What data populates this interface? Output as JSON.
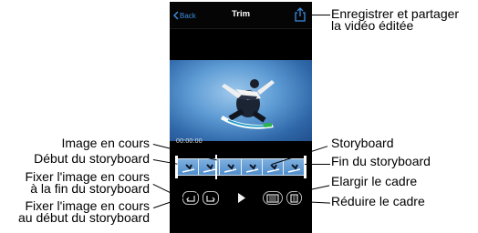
{
  "navbar": {
    "back_label": "Back",
    "title": "Trim"
  },
  "timecode": "00:00:00",
  "storyboard": {
    "frame_count": 6
  },
  "callouts": {
    "share": [
      "Enregistrer et partager",
      "la vidéo éditée"
    ],
    "current_frame": "Image en cours",
    "storyboard_start": "Début du storyboard",
    "fix_end": [
      "Fixer l'image en cours",
      "à la fin du storyboard"
    ],
    "fix_start": [
      "Fixer l'image en cours",
      "au début du storyboard"
    ],
    "storyboard": "Storyboard",
    "storyboard_end": "Fin du storyboard",
    "expand": "Elargir le cadre",
    "shrink": "Réduire le cadre",
    "play": "Lire la vidéo"
  },
  "colors": {
    "accent": "#3a8dde",
    "background": "#000000",
    "sky": "#5d9bd4"
  }
}
